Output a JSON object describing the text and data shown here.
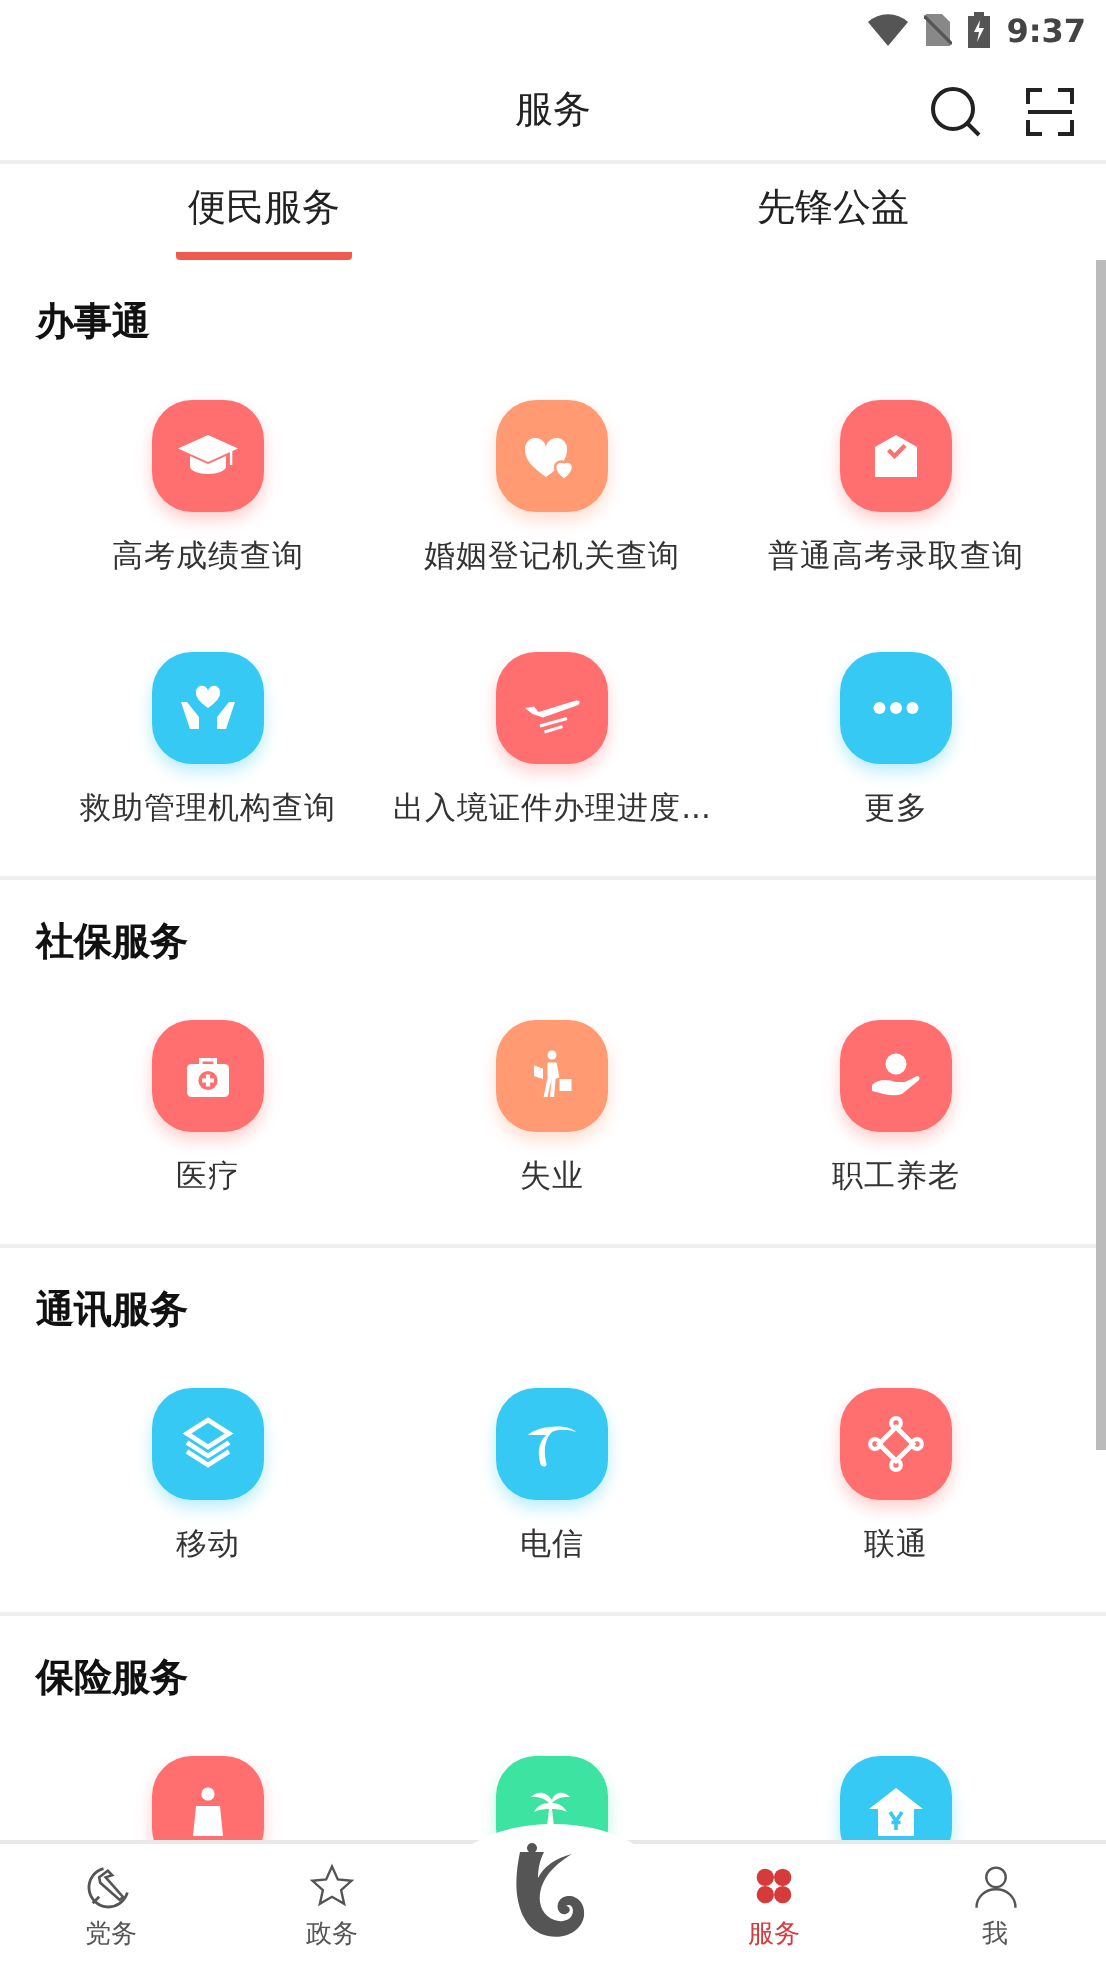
{
  "status_bar": {
    "time": "9:37"
  },
  "header": {
    "title": "服务"
  },
  "tabs": [
    {
      "label": "便民服务",
      "selected": true
    },
    {
      "label": "先锋公益",
      "selected": false
    }
  ],
  "sections": [
    {
      "title": "办事通",
      "items": [
        {
          "label": "高考成绩查询",
          "color": "#ff6f6f"
        },
        {
          "label": "婚姻登记机关查询",
          "color": "#ff9a73"
        },
        {
          "label": "普通高考录取查询",
          "color": "#ff6f6f"
        },
        {
          "label": "救助管理机构查询",
          "color": "#36c9f3"
        },
        {
          "label": "出入境证件办理进度...",
          "color": "#ff6f6f"
        },
        {
          "label": "更多",
          "color": "#36c9f3"
        }
      ]
    },
    {
      "title": "社保服务",
      "items": [
        {
          "label": "医疗",
          "color": "#ff6f6f"
        },
        {
          "label": "失业",
          "color": "#ff9a73"
        },
        {
          "label": "职工养老",
          "color": "#ff6f6f"
        }
      ]
    },
    {
      "title": "通讯服务",
      "items": [
        {
          "label": "移动",
          "color": "#36c9f3"
        },
        {
          "label": "电信",
          "color": "#36c9f3"
        },
        {
          "label": "联通",
          "color": "#ff6f6f"
        }
      ]
    },
    {
      "title": "保险服务",
      "items": [
        {
          "color": "#ff6f6f"
        },
        {
          "color": "#3de3a0"
        },
        {
          "color": "#36c9f3"
        }
      ]
    }
  ],
  "bottom_nav": [
    {
      "label": "党务",
      "selected": false
    },
    {
      "label": "政务",
      "selected": false
    },
    {
      "kind": "logo"
    },
    {
      "label": "服务",
      "selected": true
    },
    {
      "label": "我",
      "selected": false
    }
  ]
}
